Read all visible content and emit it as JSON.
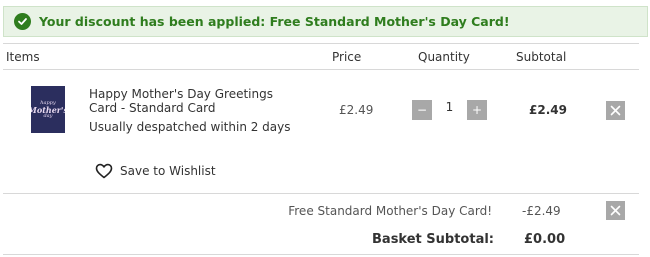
{
  "banner": {
    "icon": "check-circle-icon",
    "message": "Your discount has been applied: Free Standard Mother's Day Card!",
    "color": "#2f7d1e",
    "background": "#e9f3e6"
  },
  "table": {
    "headers": {
      "items": "Items",
      "price": "Price",
      "quantity": "Quantity",
      "subtotal": "Subtotal"
    }
  },
  "item": {
    "thumbnail_lines": [
      "happy",
      "Mother's",
      "day"
    ],
    "name": "Happy Mother's Day Greetings Card - Standard Card",
    "despatch": "Usually despatched within 2 days",
    "price": "£2.49",
    "quantity": "1",
    "minus_label": "−",
    "plus_label": "+",
    "subtotal": "£2.49",
    "remove_icon": "close-icon",
    "wishlist_icon": "heart-icon",
    "wishlist_label": "Save to Wishlist"
  },
  "discount": {
    "label": "Free Standard Mother's Day Card!",
    "value": "-£2.49",
    "remove_icon": "close-icon"
  },
  "summary": {
    "label": "Basket Subtotal:",
    "value": "£0.00"
  }
}
